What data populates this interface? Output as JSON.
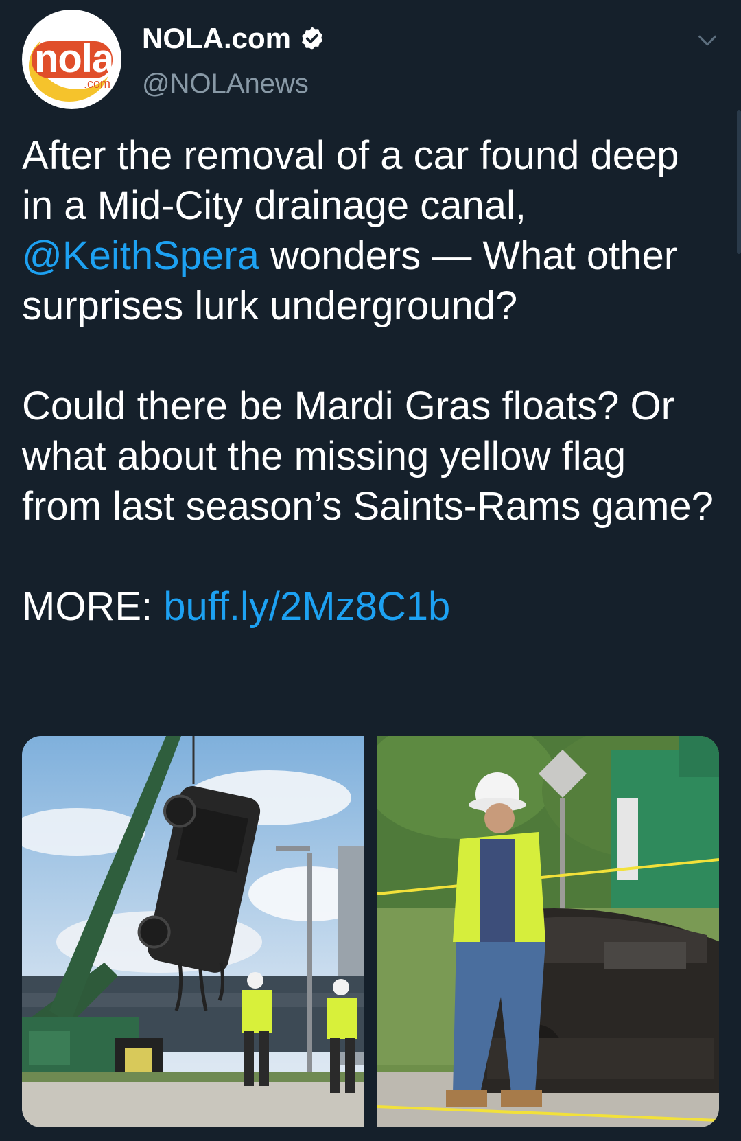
{
  "account": {
    "display_name": "NOLA.com",
    "handle": "@NOLAnews",
    "avatar_text": "nola",
    "avatar_sub": ".com",
    "verified": true
  },
  "tweet": {
    "para1_start": "After the removal of a car found deep in a Mid-City drainage canal, ",
    "mention": "@KeithSpera",
    "para1_end": " wonders — What other surprises lurk underground?",
    "para2": "Could there be Mardi Gras floats? Or what about the missing yellow flag from last season’s Saints-Rams game?",
    "more_label": "MORE: ",
    "link": "buff.ly/2Mz8C1b"
  },
  "colors": {
    "background": "#15202b",
    "link": "#1da1f2",
    "secondary_text": "#8899a6"
  },
  "icons": {
    "verified": "verified-badge-icon",
    "caret": "chevron-down-icon"
  }
}
